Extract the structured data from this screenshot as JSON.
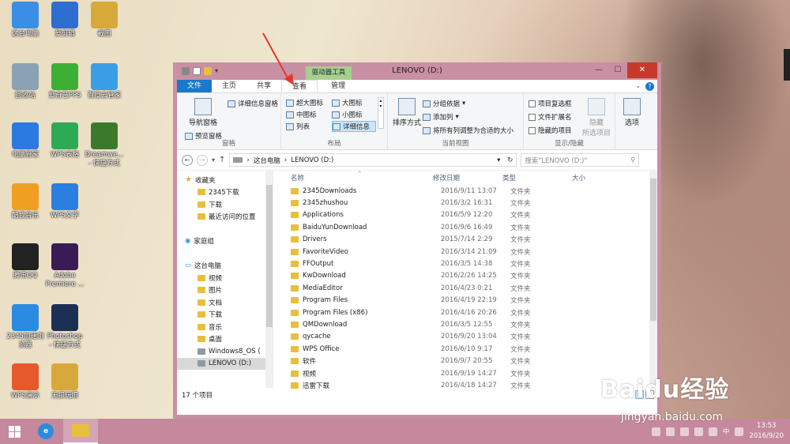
{
  "desktop_icons": [
    {
      "label": "这台电脑",
      "icon": "computer-icon",
      "color": "#3a8ee6"
    },
    {
      "label": "爱剪辑",
      "icon": "film-icon",
      "color": "#2d6fd0"
    },
    {
      "label": "截图",
      "icon": "folder-icon",
      "color": "#d7a93a"
    },
    {
      "label": "回收站",
      "icon": "recycle-bin-icon",
      "color": "#8aa2b4"
    },
    {
      "label": "爱奇艺PPS",
      "icon": "iqiyi-icon",
      "color": "#3cb035"
    },
    {
      "label": "百度云管家",
      "icon": "cloud-icon",
      "color": "#3a9ee6"
    },
    {
      "label": "电脑管家",
      "icon": "shield-icon",
      "color": "#2a7ae0"
    },
    {
      "label": "WPS表格",
      "icon": "wps-sheet-icon",
      "color": "#2daa54"
    },
    {
      "label": "Dreamwe...\n- 快捷方式",
      "icon": "dreamweaver-icon",
      "color": "#3b7a2a"
    },
    {
      "label": "酷我音乐",
      "icon": "music-icon",
      "color": "#f0a020"
    },
    {
      "label": "WPS文字",
      "icon": "wps-writer-icon",
      "color": "#2b7fe0"
    },
    {
      "label": "腾讯QQ",
      "icon": "qq-icon",
      "color": "#222222"
    },
    {
      "label": "Adobe\nPremiere ...",
      "icon": "premiere-icon",
      "color": "#3a1c55"
    },
    {
      "label": "2345加速浏\n览器",
      "icon": "browser-icon",
      "color": "#2b8be0"
    },
    {
      "label": "Photoshop\n- 快捷方式",
      "icon": "photoshop-icon",
      "color": "#1c2f55"
    },
    {
      "label": "WPS演示",
      "icon": "wps-ppt-icon",
      "color": "#e55a2a"
    },
    {
      "label": "无损玩眼",
      "icon": "folder-icon",
      "color": "#d7a93a"
    }
  ],
  "window": {
    "title": "LENOVO (D:)",
    "context_tab": "驱动器工具",
    "tabs": [
      "文件",
      "主页",
      "共享",
      "查看",
      "管理"
    ]
  },
  "ribbon": {
    "pane": {
      "nav_pane": "导航窗格",
      "preview_pane": "预览窗格",
      "details_pane": "详细信息窗格",
      "label": "窗格"
    },
    "layout": {
      "items": [
        "超大图标",
        "大图标",
        "中图标",
        "小图标",
        "列表",
        "详细信息"
      ],
      "label": "布局"
    },
    "current_view": {
      "sort": "排序方式",
      "group_by": "分组依据",
      "add_column": "添加列",
      "fit_columns": "将所有列调整为合适的大小",
      "label": "当前视图"
    },
    "show_hide": {
      "item_checkboxes": "项目复选框",
      "extensions": "文件扩展名",
      "hidden_items": "隐藏的项目",
      "hide_selected": "隐藏",
      "hide_selected2": "所选项目",
      "label": "显示/隐藏"
    },
    "options": "选项"
  },
  "address": {
    "path": [
      "这台电脑",
      "LENOVO (D:)"
    ],
    "search_placeholder": "搜索\"LENOVO (D:)\""
  },
  "nav_pane": [
    {
      "label": "收藏夹",
      "type": "star",
      "indent": 0
    },
    {
      "label": "2345下载",
      "type": "folder",
      "indent": 1
    },
    {
      "label": "下载",
      "type": "folder",
      "indent": 1
    },
    {
      "label": "最近访问的位置",
      "type": "folder",
      "indent": 1
    },
    {
      "label": "",
      "type": "spacer",
      "indent": 0
    },
    {
      "label": "家庭组",
      "type": "homegroup",
      "indent": 0
    },
    {
      "label": "",
      "type": "spacer",
      "indent": 0
    },
    {
      "label": "这台电脑",
      "type": "computer",
      "indent": 0
    },
    {
      "label": "视频",
      "type": "folder",
      "indent": 1
    },
    {
      "label": "图片",
      "type": "folder",
      "indent": 1
    },
    {
      "label": "文档",
      "type": "folder",
      "indent": 1
    },
    {
      "label": "下载",
      "type": "folder",
      "indent": 1
    },
    {
      "label": "音乐",
      "type": "folder",
      "indent": 1
    },
    {
      "label": "桌面",
      "type": "folder",
      "indent": 1
    },
    {
      "label": "Windows8_OS (",
      "type": "drive",
      "indent": 1
    },
    {
      "label": "LENOVO (D:)",
      "type": "drive",
      "indent": 1,
      "selected": true
    }
  ],
  "columns": {
    "name": "名称",
    "date": "修改日期",
    "type": "类型",
    "size": "大小"
  },
  "files": [
    {
      "name": "2345Downloads",
      "date": "2016/9/11 13:07",
      "type": "文件夹"
    },
    {
      "name": "2345zhushou",
      "date": "2016/3/2 16:31",
      "type": "文件夹"
    },
    {
      "name": "Applications",
      "date": "2016/5/9 12:20",
      "type": "文件夹"
    },
    {
      "name": "BaiduYunDownload",
      "date": "2016/9/6 16:49",
      "type": "文件夹"
    },
    {
      "name": "Drivers",
      "date": "2015/7/14 2:29",
      "type": "文件夹"
    },
    {
      "name": "FavoriteVideo",
      "date": "2016/3/14 21:09",
      "type": "文件夹"
    },
    {
      "name": "FFOutput",
      "date": "2016/3/5 14:38",
      "type": "文件夹"
    },
    {
      "name": "KwDownload",
      "date": "2016/2/26 14:25",
      "type": "文件夹"
    },
    {
      "name": "MediaEditor",
      "date": "2016/4/23 0:21",
      "type": "文件夹"
    },
    {
      "name": "Program Files",
      "date": "2016/4/19 22:19",
      "type": "文件夹"
    },
    {
      "name": "Program Files (x86)",
      "date": "2016/4/16 20:26",
      "type": "文件夹"
    },
    {
      "name": "QMDownload",
      "date": "2016/3/5 12:55",
      "type": "文件夹"
    },
    {
      "name": "qycache",
      "date": "2016/9/20 13:04",
      "type": "文件夹"
    },
    {
      "name": "WPS Office",
      "date": "2016/6/10 9:17",
      "type": "文件夹"
    },
    {
      "name": "软件",
      "date": "2016/9/7 20:55",
      "type": "文件夹"
    },
    {
      "name": "视频",
      "date": "2016/9/19 14:27",
      "type": "文件夹"
    },
    {
      "name": "迅雷下载",
      "date": "2016/4/18 14:27",
      "type": "文件夹"
    }
  ],
  "status": {
    "item_count": "17 个项目"
  },
  "taskbar": {
    "time": "13:53",
    "date": "2016/9/20",
    "ime": "中"
  },
  "watermark": {
    "main": "Baidu经验",
    "url": "jingyan.baidu.com"
  },
  "colors": {
    "accent": "#1979ca",
    "window_border": "#c98fa2",
    "taskbar": "#c5889c",
    "close": "#c7392b",
    "arrow": "#e8372a"
  }
}
